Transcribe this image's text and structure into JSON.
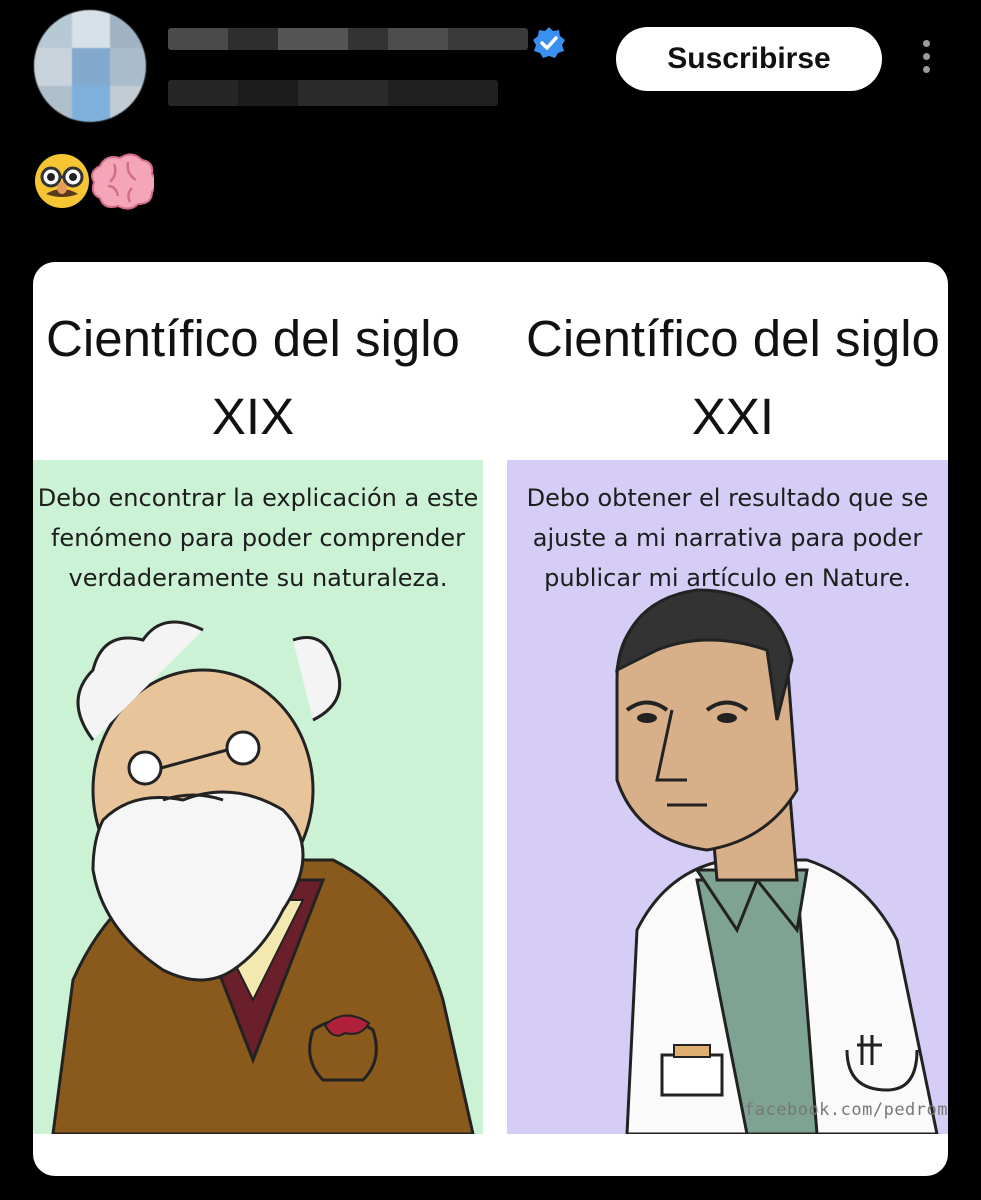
{
  "header": {
    "avatar_icon": "blurred-profile-avatar",
    "verified_icon": "verified-badge-icon",
    "subscribe_label": "Suscribirse",
    "more_icon": "vertical-ellipsis-icon"
  },
  "post": {
    "emojis": [
      "disguised-face-emoji",
      "brain-emoji"
    ],
    "image": {
      "left_title": "Científico del siglo XIX",
      "right_title": "Científico del siglo XXI",
      "left_caption": "Debo encontrar la explicación a este fenómeno para poder comprender verdaderamente su naturaleza.",
      "right_caption": "Debo obtener el resultado que se ajuste a mi narrativa para poder publicar mi artículo en Nature.",
      "credit": "facebook.com/pedrom"
    }
  },
  "colors": {
    "background": "#000000",
    "left_panel": "#ccf2d5",
    "right_panel": "#d5cdf5",
    "verified": "#3b8ff0"
  }
}
